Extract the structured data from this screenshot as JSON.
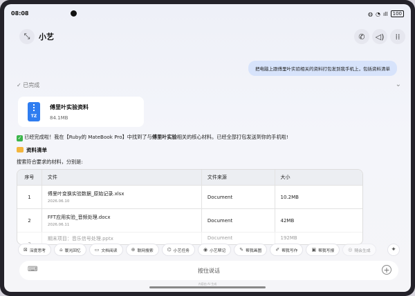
{
  "status": {
    "time": "08:08",
    "battery": "100"
  },
  "header": {
    "title": "小艺"
  },
  "user_message": "把电脑上跟傅里叶实验相关的资料打包发到我手机上，包括资料清单",
  "status_row": {
    "label": "已完成"
  },
  "file_card": {
    "icon_label": "TZ",
    "name": "傅里叶实验资料",
    "size": "84.1MB"
  },
  "result": {
    "prefix": "已经完成啦！我在【Ruby的 MateBook Pro】中找到了与",
    "highlight": "傅里叶实验",
    "suffix": "相关的核心材料。已经全部打包发送到你的手机啦!"
  },
  "list_title": "资料清单",
  "search_text": "搜索符合要求的材料，分别是:",
  "table": {
    "headers": [
      "序号",
      "文件",
      "文件来源",
      "大小"
    ],
    "rows": [
      {
        "no": "1",
        "name": "傅里叶变换实验数据_原始记录.xlsx",
        "date": "2026.06.10",
        "source": "Document",
        "size": "10.2MB"
      },
      {
        "no": "2",
        "name": "FFT应用实验_音频处理.docx",
        "date": "2026.06.11",
        "source": "Document",
        "size": "42MB"
      },
      {
        "no": "3",
        "name": "期末项目：音乐信号处理.pptx",
        "date": "",
        "source": "Document",
        "size": "192MB"
      }
    ]
  },
  "chips": [
    {
      "icon": "deep-think-icon",
      "label": "深度思考"
    },
    {
      "icon": "memory-icon",
      "label": "寰光回忆"
    },
    {
      "icon": "doc-read-icon",
      "label": "文档阅读"
    },
    {
      "icon": "web-search-icon",
      "label": "联网搜索"
    },
    {
      "icon": "task-icon",
      "label": "小艺任务"
    },
    {
      "icon": "note-icon",
      "label": "小艺帮记"
    },
    {
      "icon": "draw-icon",
      "label": "帮我画图"
    },
    {
      "icon": "write-icon",
      "label": "帮我写作"
    },
    {
      "icon": "ppt-icon",
      "label": "帮我写报"
    },
    {
      "icon": "record-icon",
      "label": "随会生成"
    }
  ],
  "input": {
    "placeholder": "按住说话"
  },
  "disclaimer": "内容由 AI 生成"
}
